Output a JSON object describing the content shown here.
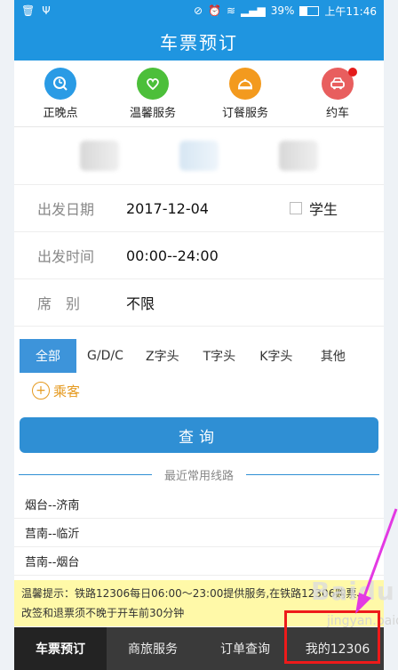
{
  "status": {
    "battery": "39%",
    "time": "上午11:46"
  },
  "header": {
    "title": "车票预订"
  },
  "services": [
    {
      "label": "正晚点",
      "icon": "clock-search-icon",
      "color": "#2a9be5"
    },
    {
      "label": "温馨服务",
      "icon": "heart-hand-icon",
      "color": "#4cbf3a"
    },
    {
      "label": "订餐服务",
      "icon": "food-cover-icon",
      "color": "#f39a1e"
    },
    {
      "label": "约车",
      "icon": "car-icon",
      "color": "#e85e5e"
    }
  ],
  "form": {
    "date_label": "出发日期",
    "date_value": "2017-12-04",
    "student_label": "学生",
    "time_label": "出发时间",
    "time_value": "00:00--24:00",
    "seat_label": "席　别",
    "seat_value": "不限"
  },
  "train_tabs": [
    "全部",
    "G/D/C",
    "Z字头",
    "T字头",
    "K字头",
    "其他"
  ],
  "passenger_label": "乘客",
  "query_label": "查询",
  "recent": {
    "title": "最近常用线路",
    "routes": [
      "烟台--济南",
      "莒南--临沂",
      "莒南--烟台"
    ]
  },
  "tip": "温馨提示：铁路12306每日06:00～23:00提供服务,在铁路12306购票、改签和退票须不晚于开车前30分钟",
  "bottom_nav": [
    "车票预订",
    "商旅服务",
    "订单查询",
    "我的12306"
  ],
  "watermark": {
    "main": "Baidu",
    "sub": "jingyan.baidu"
  }
}
